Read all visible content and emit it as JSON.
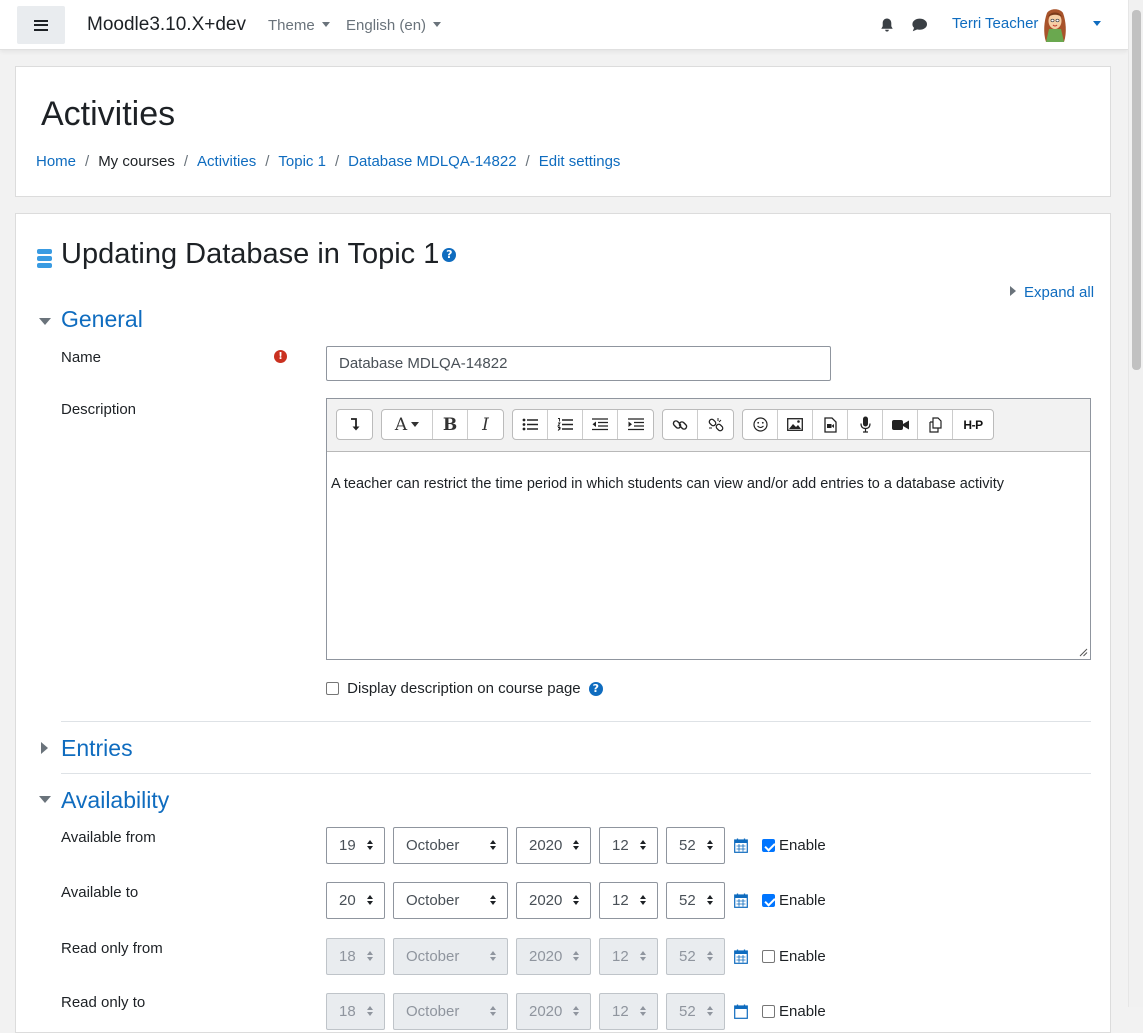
{
  "navbar": {
    "brand": "Moodle3.10.X+dev",
    "theme_label": "Theme",
    "language_label": "English (en)",
    "user_name": "Terri Teacher",
    "icons": [
      "menu-icon",
      "bell-icon",
      "chat-icon",
      "avatar",
      "chevron-down-icon"
    ]
  },
  "header": {
    "title": "Activities",
    "breadcrumb": [
      "Home",
      "My courses",
      "Activities",
      "Topic 1",
      "Database MDLQA-14822",
      "Edit settings"
    ]
  },
  "form": {
    "title": "Updating Database in Topic 1",
    "expand_all": "Expand all",
    "general": {
      "heading": "General",
      "name_label": "Name",
      "name_value": "Database MDLQA-14822",
      "description_label": "Description",
      "description_text": "A teacher can restrict the time period in which students can view and/or add entries to a database activity",
      "display_description_label": "Display description on course page",
      "display_description_checked": false
    },
    "entries_heading": "Entries",
    "availability": {
      "heading": "Availability",
      "enable_label": "Enable",
      "rows": [
        {
          "label": "Available from",
          "day": "19",
          "month": "October",
          "year": "2020",
          "hour": "12",
          "minute": "52",
          "enabled": true
        },
        {
          "label": "Available to",
          "day": "20",
          "month": "October",
          "year": "2020",
          "hour": "12",
          "minute": "52",
          "enabled": true
        },
        {
          "label": "Read only from",
          "day": "18",
          "month": "October",
          "year": "2020",
          "hour": "12",
          "minute": "52",
          "enabled": false
        },
        {
          "label": "Read only to",
          "day": "18",
          "month": "October",
          "year": "2020",
          "hour": "12",
          "minute": "52",
          "enabled": false
        }
      ]
    }
  },
  "editor_toolbar": [
    "expand-toolbar",
    "font-color",
    "bold",
    "italic",
    "unordered-list",
    "ordered-list",
    "outdent",
    "indent",
    "link",
    "unlink",
    "emoticon",
    "image",
    "media",
    "record-audio",
    "record-video",
    "manage-files",
    "h5p"
  ],
  "colors": {
    "link": "#0f6cbf",
    "required": "#ca3120",
    "checkbox": "#0075ff"
  }
}
